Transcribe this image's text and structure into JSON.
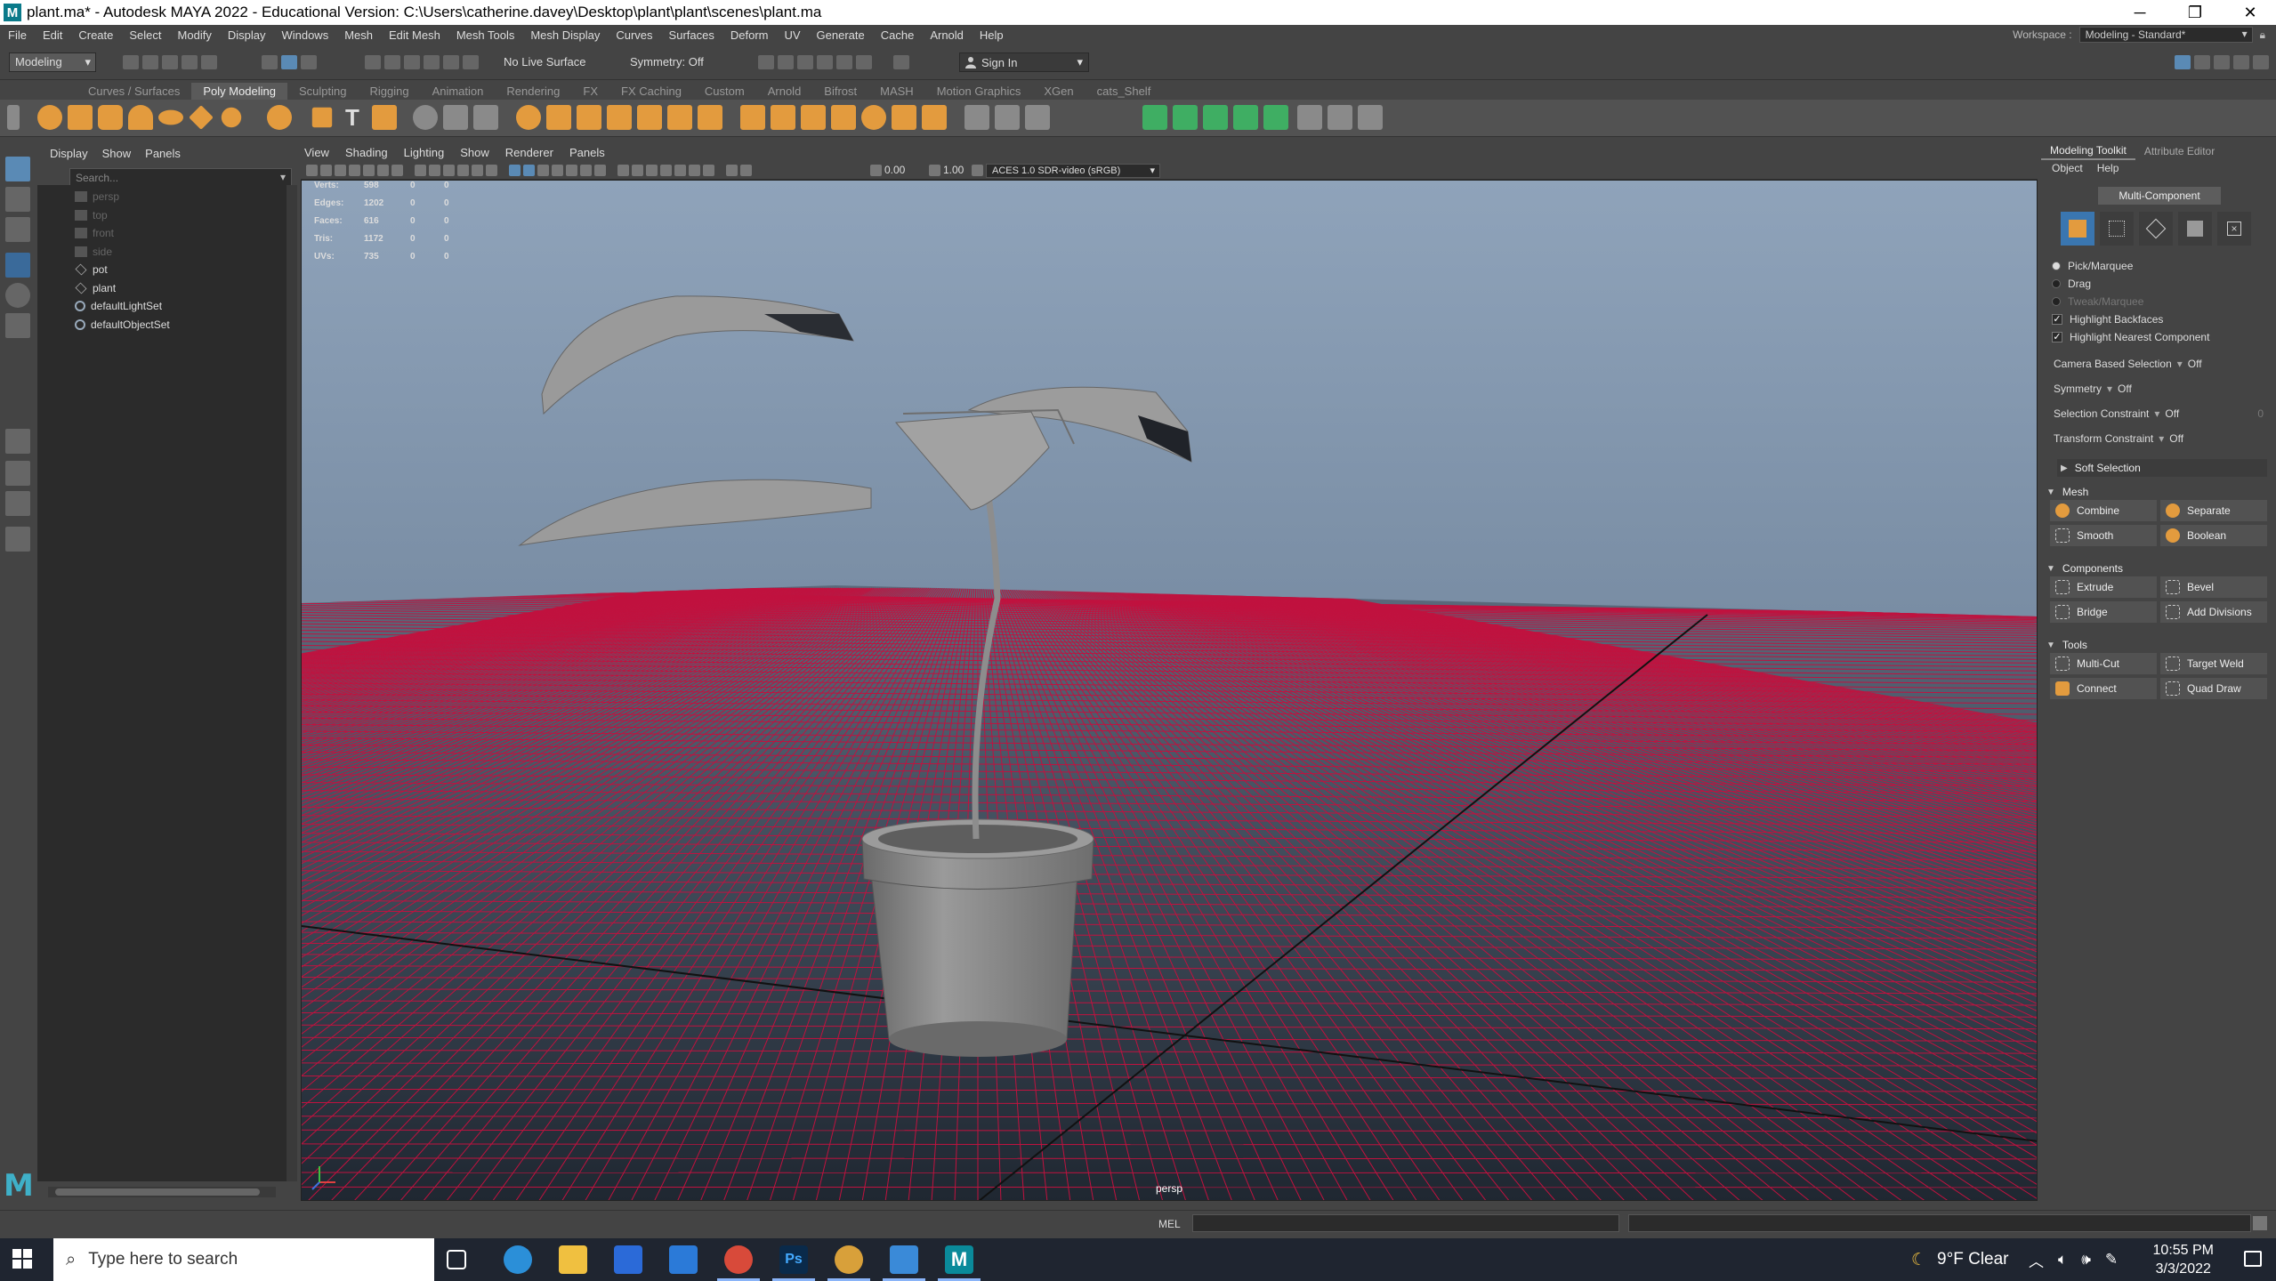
{
  "window": {
    "title": "plant.ma* - Autodesk MAYA 2022 - Educational Version: C:\\Users\\catherine.davey\\Desktop\\plant\\plant\\scenes\\plant.ma",
    "minimize": "─",
    "restore": "❐",
    "close": "✕"
  },
  "menubar": {
    "items": [
      "File",
      "Edit",
      "Create",
      "Select",
      "Modify",
      "Display",
      "Windows",
      "Mesh",
      "Edit Mesh",
      "Mesh Tools",
      "Mesh Display",
      "Curves",
      "Surfaces",
      "Deform",
      "UV",
      "Generate",
      "Cache",
      "Arnold",
      "Help"
    ],
    "workspace_label": "Workspace :",
    "workspace_value": "Modeling - Standard*"
  },
  "statusline": {
    "mode": "Modeling",
    "live_surface": "No Live Surface",
    "symmetry": "Symmetry: Off",
    "sign_in": "Sign In"
  },
  "shelf": {
    "tabs": [
      "Curves / Surfaces",
      "Poly Modeling",
      "Sculpting",
      "Rigging",
      "Animation",
      "Rendering",
      "FX",
      "FX Caching",
      "Custom",
      "Arnold",
      "Bifrost",
      "MASH",
      "Motion Graphics",
      "XGen",
      "cats_Shelf"
    ],
    "active_tab": "Poly Modeling"
  },
  "outliner": {
    "menu": [
      "Display",
      "Show",
      "Panels"
    ],
    "search_placeholder": "Search...",
    "items": [
      {
        "label": "persp",
        "icon": "camera-icon",
        "dim": true
      },
      {
        "label": "top",
        "icon": "camera-icon",
        "dim": true
      },
      {
        "label": "front",
        "icon": "camera-icon",
        "dim": true
      },
      {
        "label": "side",
        "icon": "camera-icon",
        "dim": true
      },
      {
        "label": "pot",
        "icon": "mesh-icon",
        "dim": false
      },
      {
        "label": "plant",
        "icon": "mesh-icon",
        "dim": false
      },
      {
        "label": "defaultLightSet",
        "icon": "set-icon",
        "dim": false
      },
      {
        "label": "defaultObjectSet",
        "icon": "set-icon",
        "dim": false
      }
    ]
  },
  "viewport": {
    "menu": [
      "View",
      "Shading",
      "Lighting",
      "Show",
      "Renderer",
      "Panels"
    ],
    "value_a": "0.00",
    "value_b": "1.00",
    "color_space": "ACES 1.0 SDR-video (sRGB)",
    "camera_label": "persp",
    "hud": [
      {
        "label": "Verts:",
        "v1": "598",
        "v2": "0",
        "v3": "0"
      },
      {
        "label": "Edges:",
        "v1": "1202",
        "v2": "0",
        "v3": "0"
      },
      {
        "label": "Faces:",
        "v1": "616",
        "v2": "0",
        "v3": "0"
      },
      {
        "label": "Tris:",
        "v1": "1172",
        "v2": "0",
        "v3": "0"
      },
      {
        "label": "UVs:",
        "v1": "735",
        "v2": "0",
        "v3": "0"
      }
    ],
    "colors": {
      "sky_top": "#8fa3ba",
      "sky_bottom": "#5b6f86",
      "grid": "#c0123f",
      "floor_dark": "#1f2731",
      "mesh": "#8a8a8a"
    }
  },
  "modeling_toolkit": {
    "tabs": [
      "Modeling Toolkit",
      "Attribute Editor"
    ],
    "submenu": [
      "Object",
      "Help"
    ],
    "multi_component": "Multi-Component",
    "pick_marquee": "Pick/Marquee",
    "drag": "Drag",
    "tweak_marquee": "Tweak/Marquee",
    "highlight_backfaces": "Highlight Backfaces",
    "highlight_nearest": "Highlight Nearest Component",
    "camera_based_selection": "Camera Based Selection",
    "camera_based_value": "Off",
    "symmetry": "Symmetry",
    "symmetry_value": "Off",
    "selection_constraint": "Selection Constraint",
    "selection_constraint_value": "Off",
    "selection_constraint_num": "0",
    "transform_constraint": "Transform Constraint",
    "transform_constraint_value": "Off",
    "soft_selection": "Soft Selection",
    "mesh_section": "Mesh",
    "combine": "Combine",
    "separate": "Separate",
    "smooth": "Smooth",
    "boolean": "Boolean",
    "components_section": "Components",
    "extrude": "Extrude",
    "bevel": "Bevel",
    "bridge": "Bridge",
    "add_divisions": "Add Divisions",
    "tools_section": "Tools",
    "multi_cut": "Multi-Cut",
    "target_weld": "Target Weld",
    "connect": "Connect",
    "quad_draw": "Quad Draw"
  },
  "cmdline": {
    "label": "MEL"
  },
  "taskbar": {
    "search_placeholder": "Type here to search",
    "weather": "9°F  Clear",
    "time": "10:55 PM",
    "date": "3/3/2022"
  }
}
